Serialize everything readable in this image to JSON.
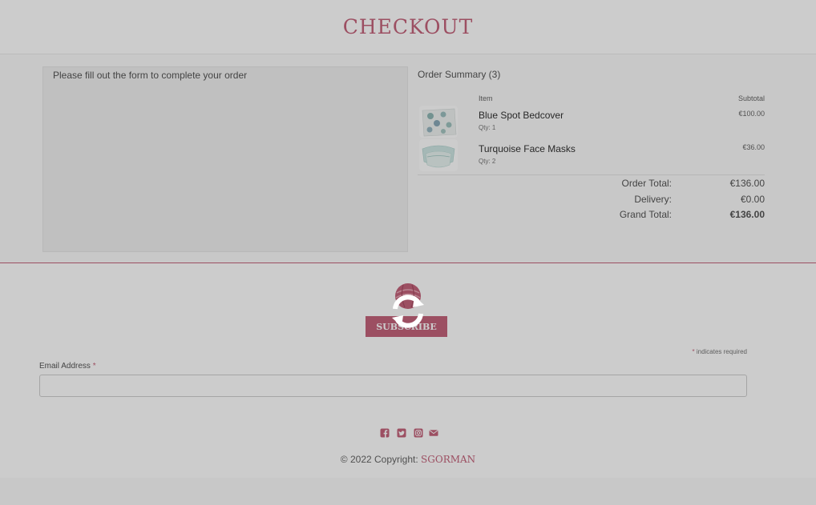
{
  "header": {
    "title": "CHECKOUT"
  },
  "form": {
    "message": "Please fill out the form to complete your order"
  },
  "order_summary": {
    "title": "Order Summary (3)",
    "columns": {
      "item": "Item",
      "subtotal": "Subtotal"
    },
    "items": [
      {
        "name": "Blue Spot Bedcover",
        "qty": "Qty: 1",
        "subtotal": "€100.00",
        "thumb": "bedcover-image"
      },
      {
        "name": "Turquoise Face Masks",
        "qty": "Qty: 2",
        "subtotal": "€36.00",
        "thumb": "face-masks-image"
      }
    ],
    "totals": [
      {
        "label": "Order Total:",
        "value": "€136.00"
      },
      {
        "label": "Delivery:",
        "value": "€0.00"
      },
      {
        "label": "Grand Total:",
        "value": "€136.00"
      }
    ]
  },
  "subscribe": {
    "button": "SUBSCRIBE",
    "required_note": "indicates required",
    "required_marker": "*",
    "email_label": "Email Address",
    "email_value": ""
  },
  "footer": {
    "socials": [
      "facebook-icon",
      "twitter-icon",
      "instagram-icon",
      "envelope-icon"
    ],
    "copyright": "© 2022 Copyright:",
    "brand": "SGORMAN"
  },
  "colors": {
    "accent": "#c4637b",
    "overlay": "rgba(0,0,0,0.2)"
  },
  "loading": {
    "icon": "loading-spinner-icon",
    "visible": true
  }
}
